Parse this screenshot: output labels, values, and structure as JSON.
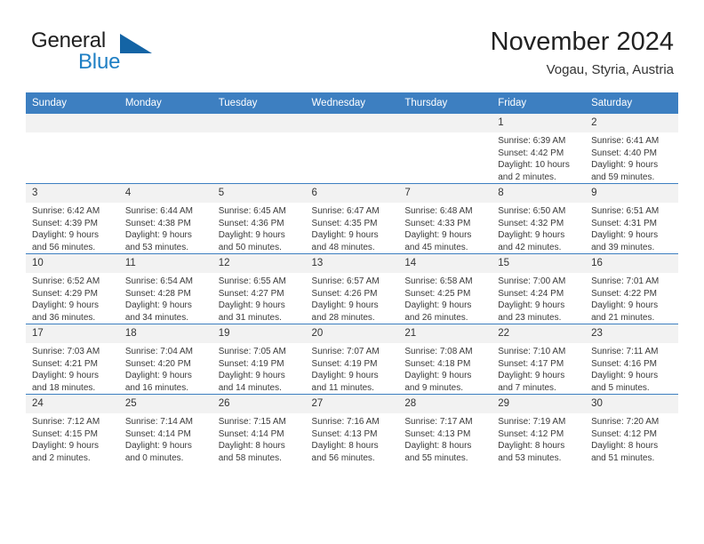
{
  "brand": {
    "word_one": "General",
    "word_two": "Blue",
    "triangle_icon": "blue-triangle-logo-icon"
  },
  "header": {
    "month_title": "November 2024",
    "location": "Vogau, Styria, Austria"
  },
  "colors": {
    "header_blue": "#3d7fc1",
    "brand_blue": "#1f7fc4",
    "triangle_blue": "#1464a5",
    "daynum_background": "#f2f2f2",
    "text": "#333333"
  },
  "calendar": {
    "weekday_headers": [
      "Sunday",
      "Monday",
      "Tuesday",
      "Wednesday",
      "Thursday",
      "Friday",
      "Saturday"
    ],
    "weeks": [
      [
        {
          "day": "",
          "empty": true
        },
        {
          "day": "",
          "empty": true
        },
        {
          "day": "",
          "empty": true
        },
        {
          "day": "",
          "empty": true
        },
        {
          "day": "",
          "empty": true
        },
        {
          "day": "1",
          "sunrise": "Sunrise: 6:39 AM",
          "sunset": "Sunset: 4:42 PM",
          "daylight": "Daylight: 10 hours and 2 minutes."
        },
        {
          "day": "2",
          "sunrise": "Sunrise: 6:41 AM",
          "sunset": "Sunset: 4:40 PM",
          "daylight": "Daylight: 9 hours and 59 minutes."
        }
      ],
      [
        {
          "day": "3",
          "sunrise": "Sunrise: 6:42 AM",
          "sunset": "Sunset: 4:39 PM",
          "daylight": "Daylight: 9 hours and 56 minutes."
        },
        {
          "day": "4",
          "sunrise": "Sunrise: 6:44 AM",
          "sunset": "Sunset: 4:38 PM",
          "daylight": "Daylight: 9 hours and 53 minutes."
        },
        {
          "day": "5",
          "sunrise": "Sunrise: 6:45 AM",
          "sunset": "Sunset: 4:36 PM",
          "daylight": "Daylight: 9 hours and 50 minutes."
        },
        {
          "day": "6",
          "sunrise": "Sunrise: 6:47 AM",
          "sunset": "Sunset: 4:35 PM",
          "daylight": "Daylight: 9 hours and 48 minutes."
        },
        {
          "day": "7",
          "sunrise": "Sunrise: 6:48 AM",
          "sunset": "Sunset: 4:33 PM",
          "daylight": "Daylight: 9 hours and 45 minutes."
        },
        {
          "day": "8",
          "sunrise": "Sunrise: 6:50 AM",
          "sunset": "Sunset: 4:32 PM",
          "daylight": "Daylight: 9 hours and 42 minutes."
        },
        {
          "day": "9",
          "sunrise": "Sunrise: 6:51 AM",
          "sunset": "Sunset: 4:31 PM",
          "daylight": "Daylight: 9 hours and 39 minutes."
        }
      ],
      [
        {
          "day": "10",
          "sunrise": "Sunrise: 6:52 AM",
          "sunset": "Sunset: 4:29 PM",
          "daylight": "Daylight: 9 hours and 36 minutes."
        },
        {
          "day": "11",
          "sunrise": "Sunrise: 6:54 AM",
          "sunset": "Sunset: 4:28 PM",
          "daylight": "Daylight: 9 hours and 34 minutes."
        },
        {
          "day": "12",
          "sunrise": "Sunrise: 6:55 AM",
          "sunset": "Sunset: 4:27 PM",
          "daylight": "Daylight: 9 hours and 31 minutes."
        },
        {
          "day": "13",
          "sunrise": "Sunrise: 6:57 AM",
          "sunset": "Sunset: 4:26 PM",
          "daylight": "Daylight: 9 hours and 28 minutes."
        },
        {
          "day": "14",
          "sunrise": "Sunrise: 6:58 AM",
          "sunset": "Sunset: 4:25 PM",
          "daylight": "Daylight: 9 hours and 26 minutes."
        },
        {
          "day": "15",
          "sunrise": "Sunrise: 7:00 AM",
          "sunset": "Sunset: 4:24 PM",
          "daylight": "Daylight: 9 hours and 23 minutes."
        },
        {
          "day": "16",
          "sunrise": "Sunrise: 7:01 AM",
          "sunset": "Sunset: 4:22 PM",
          "daylight": "Daylight: 9 hours and 21 minutes."
        }
      ],
      [
        {
          "day": "17",
          "sunrise": "Sunrise: 7:03 AM",
          "sunset": "Sunset: 4:21 PM",
          "daylight": "Daylight: 9 hours and 18 minutes."
        },
        {
          "day": "18",
          "sunrise": "Sunrise: 7:04 AM",
          "sunset": "Sunset: 4:20 PM",
          "daylight": "Daylight: 9 hours and 16 minutes."
        },
        {
          "day": "19",
          "sunrise": "Sunrise: 7:05 AM",
          "sunset": "Sunset: 4:19 PM",
          "daylight": "Daylight: 9 hours and 14 minutes."
        },
        {
          "day": "20",
          "sunrise": "Sunrise: 7:07 AM",
          "sunset": "Sunset: 4:19 PM",
          "daylight": "Daylight: 9 hours and 11 minutes."
        },
        {
          "day": "21",
          "sunrise": "Sunrise: 7:08 AM",
          "sunset": "Sunset: 4:18 PM",
          "daylight": "Daylight: 9 hours and 9 minutes."
        },
        {
          "day": "22",
          "sunrise": "Sunrise: 7:10 AM",
          "sunset": "Sunset: 4:17 PM",
          "daylight": "Daylight: 9 hours and 7 minutes."
        },
        {
          "day": "23",
          "sunrise": "Sunrise: 7:11 AM",
          "sunset": "Sunset: 4:16 PM",
          "daylight": "Daylight: 9 hours and 5 minutes."
        }
      ],
      [
        {
          "day": "24",
          "sunrise": "Sunrise: 7:12 AM",
          "sunset": "Sunset: 4:15 PM",
          "daylight": "Daylight: 9 hours and 2 minutes."
        },
        {
          "day": "25",
          "sunrise": "Sunrise: 7:14 AM",
          "sunset": "Sunset: 4:14 PM",
          "daylight": "Daylight: 9 hours and 0 minutes."
        },
        {
          "day": "26",
          "sunrise": "Sunrise: 7:15 AM",
          "sunset": "Sunset: 4:14 PM",
          "daylight": "Daylight: 8 hours and 58 minutes."
        },
        {
          "day": "27",
          "sunrise": "Sunrise: 7:16 AM",
          "sunset": "Sunset: 4:13 PM",
          "daylight": "Daylight: 8 hours and 56 minutes."
        },
        {
          "day": "28",
          "sunrise": "Sunrise: 7:17 AM",
          "sunset": "Sunset: 4:13 PM",
          "daylight": "Daylight: 8 hours and 55 minutes."
        },
        {
          "day": "29",
          "sunrise": "Sunrise: 7:19 AM",
          "sunset": "Sunset: 4:12 PM",
          "daylight": "Daylight: 8 hours and 53 minutes."
        },
        {
          "day": "30",
          "sunrise": "Sunrise: 7:20 AM",
          "sunset": "Sunset: 4:12 PM",
          "daylight": "Daylight: 8 hours and 51 minutes."
        }
      ]
    ]
  }
}
